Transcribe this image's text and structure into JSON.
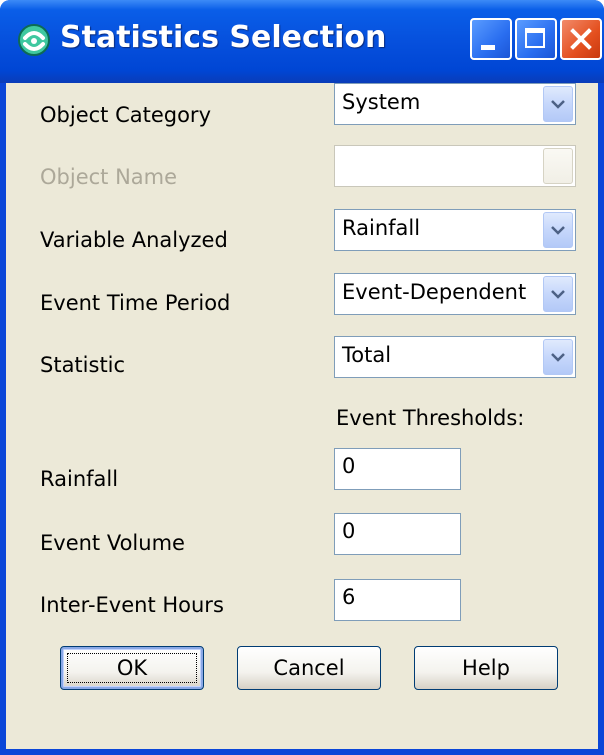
{
  "window": {
    "title": "Statistics Selection",
    "icon": "app-icon"
  },
  "titlebar_buttons": {
    "minimize": "minimize-icon",
    "maximize": "maximize-icon",
    "close": "close-icon"
  },
  "fields": {
    "object_category": {
      "label": "Object Category",
      "value": "System"
    },
    "object_name": {
      "label": "Object Name",
      "value": ""
    },
    "variable_analyzed": {
      "label": "Variable Analyzed",
      "value": "Rainfall"
    },
    "event_time_period": {
      "label": "Event Time Period",
      "value": "Event-Dependent"
    },
    "statistic": {
      "label": "Statistic",
      "value": "Total"
    }
  },
  "thresholds": {
    "heading": "Event Thresholds:",
    "rainfall": {
      "label": "Rainfall",
      "value": "0"
    },
    "event_volume": {
      "label": "Event Volume",
      "value": "0"
    },
    "inter_event_hours": {
      "label": "Inter-Event Hours",
      "value": "6"
    }
  },
  "buttons": {
    "ok": "OK",
    "cancel": "Cancel",
    "help": "Help"
  },
  "colors": {
    "titlebar": "#0650dd",
    "dialog_background": "#ece9d8",
    "disabled_text": "#aca899",
    "close_button": "#e4501f"
  }
}
